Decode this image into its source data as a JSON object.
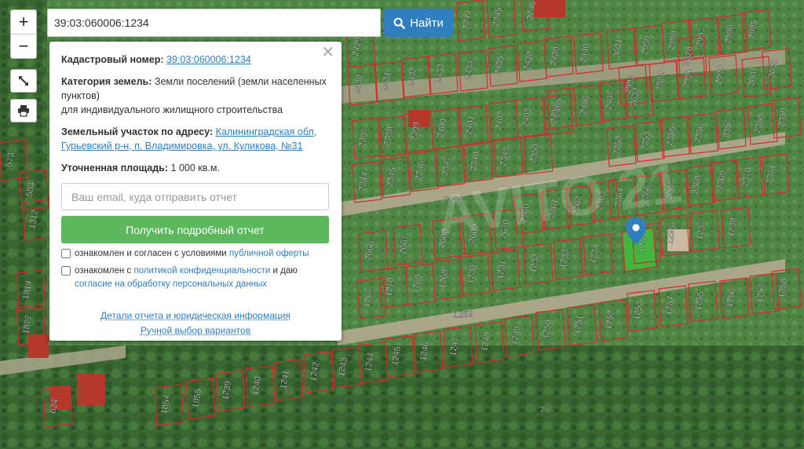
{
  "search": {
    "value": "39:03:060006:1234",
    "button_label": "Найти",
    "button_icon": "search-icon"
  },
  "controls": {
    "zoom_in": "+",
    "zoom_out": "−",
    "fullscreen_icon": "expand-icon",
    "print_icon": "printer-icon"
  },
  "popup": {
    "cadastral_label": "Кадастровый номер:",
    "cadastral_value": "39:03:060006:1234",
    "category_label": "Категория земель:",
    "category_value": "Земли поселений (земли населенных пунктов)",
    "category_use": "для индивидуального жилищного строительства",
    "address_label": "Земельный участок по адресу:",
    "address_value": "Калининградская обл, Гурьевский р-н, п. Владимировка, ул. Куликова, №31",
    "area_label": "Уточненная площадь:",
    "area_value": "1 000 кв.м.",
    "email_placeholder": "Ваш email, куда отправить отчет",
    "report_button": "Получить подробный отчет",
    "consent1_text": "ознакомлен и согласен с условиями",
    "consent1_link": "публичной оферты",
    "consent2_text": "ознакомлен с",
    "consent2_link": "политикой конфиденциальности",
    "consent2_mid": "и даю",
    "consent2_link2": "согласие на обработку персональных данных",
    "details_link": "Детали отчета и юридическая информация",
    "manual_link": "Ручной выбор вариантов"
  },
  "map": {
    "colors": {
      "vegetation": "#3f6b35",
      "parcel_border": "#d62a2a",
      "selected_parcel": "#3fbf3f",
      "marker": "#2f7fc0",
      "road": "#a8a08a"
    },
    "watermark": "AVITO 21",
    "road_labels": [
      "2372",
      "1259",
      "27"
    ],
    "parcels": [
      {
        "n": "2244"
      },
      {
        "n": "2245"
      },
      {
        "n": "2246"
      },
      {
        "n": "3628"
      },
      {
        "n": "2429"
      },
      {
        "n": "2430"
      },
      {
        "n": "2431"
      },
      {
        "n": "2432"
      },
      {
        "n": "2433"
      },
      {
        "n": "2434"
      },
      {
        "n": "2435"
      },
      {
        "n": "2438"
      },
      {
        "n": "2439"
      },
      {
        "n": "2440"
      },
      {
        "n": "3631"
      },
      {
        "n": "2999"
      },
      {
        "n": "2998"
      },
      {
        "n": "2997"
      },
      {
        "n": "2996"
      },
      {
        "n": "2995"
      },
      {
        "n": "3630"
      },
      {
        "n": "2993"
      },
      {
        "n": "2992"
      },
      {
        "n": "2991"
      },
      {
        "n": "2990"
      },
      {
        "n": "3001"
      },
      {
        "n": "2405"
      },
      {
        "n": "2406"
      },
      {
        "n": "2407"
      },
      {
        "n": "3632"
      },
      {
        "n": "2397"
      },
      {
        "n": "2398"
      },
      {
        "n": "2399"
      },
      {
        "n": "2400"
      },
      {
        "n": "2401"
      },
      {
        "n": "2402"
      },
      {
        "n": "2403"
      },
      {
        "n": "2404"
      },
      {
        "n": "2355"
      },
      {
        "n": "2356"
      },
      {
        "n": "2357"
      },
      {
        "n": "2358"
      },
      {
        "n": "2359"
      },
      {
        "n": "2353"
      },
      {
        "n": "2352"
      },
      {
        "n": "2350"
      },
      {
        "n": "2349"
      },
      {
        "n": "2348"
      },
      {
        "n": "2347"
      },
      {
        "n": "2346"
      },
      {
        "n": "2345"
      },
      {
        "n": "2344"
      },
      {
        "n": "2364"
      },
      {
        "n": "2366"
      },
      {
        "n": "2367"
      },
      {
        "n": "2368"
      },
      {
        "n": "2369"
      },
      {
        "n": "2370"
      },
      {
        "n": "2371"
      },
      {
        "n": "2360"
      },
      {
        "n": "2361"
      },
      {
        "n": "2362"
      },
      {
        "n": "2363"
      },
      {
        "n": "2670"
      },
      {
        "n": "2669"
      },
      {
        "n": "2668"
      },
      {
        "n": "2667"
      },
      {
        "n": "2666"
      },
      {
        "n": "1236"
      },
      {
        "n": "1237"
      },
      {
        "n": "1238"
      },
      {
        "n": "1235"
      },
      {
        "n": "1234"
      },
      {
        "n": "1233"
      },
      {
        "n": "1232"
      },
      {
        "n": "1231"
      },
      {
        "n": "1230"
      },
      {
        "n": "1270"
      },
      {
        "n": "1269"
      },
      {
        "n": "1268"
      },
      {
        "n": "1267"
      },
      {
        "n": "1253"
      },
      {
        "n": "1254"
      },
      {
        "n": "1255"
      },
      {
        "n": "1256"
      },
      {
        "n": "1257"
      },
      {
        "n": "1258"
      },
      {
        "n": "1252"
      },
      {
        "n": "1251"
      },
      {
        "n": "1250"
      },
      {
        "n": "1249"
      },
      {
        "n": "1248"
      },
      {
        "n": "1247"
      },
      {
        "n": "1246"
      },
      {
        "n": "1245"
      },
      {
        "n": "1244"
      },
      {
        "n": "1243"
      },
      {
        "n": "1242"
      },
      {
        "n": "1241"
      },
      {
        "n": "1240"
      },
      {
        "n": "1239"
      },
      {
        "n": "1855"
      },
      {
        "n": "1854"
      },
      {
        "n": "573"
      },
      {
        "n": "583"
      },
      {
        "n": "1312"
      },
      {
        "n": "1814"
      },
      {
        "n": "1877"
      },
      {
        "n": "624"
      }
    ]
  }
}
